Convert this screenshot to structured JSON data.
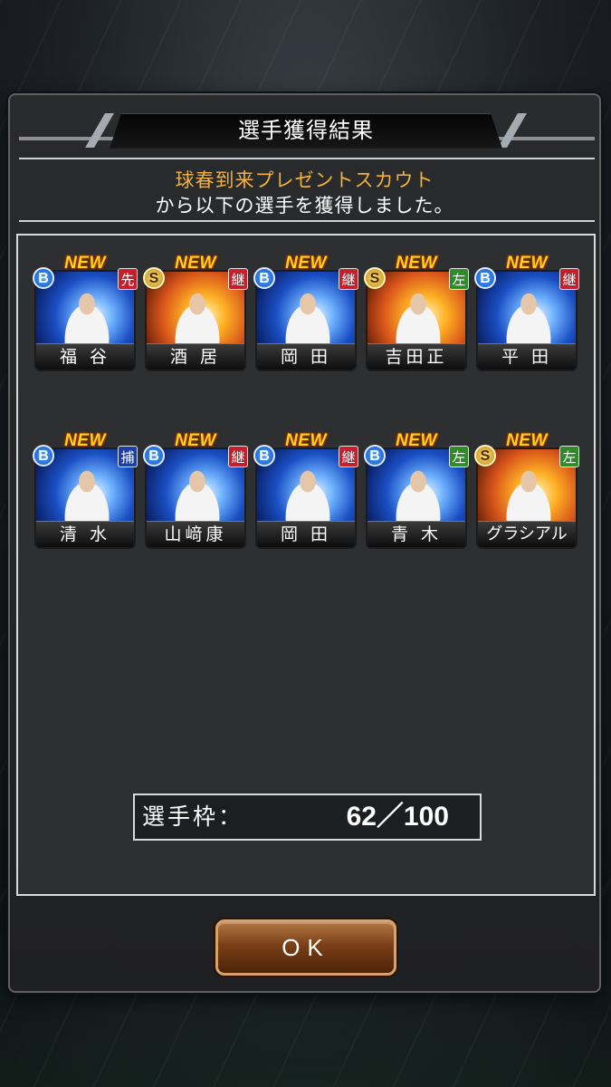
{
  "dialog": {
    "title": "選手獲得結果",
    "subtitle_highlight": "球春到来プレゼントスカウト",
    "subtitle_text": "から以下の選手を獲得しました。"
  },
  "new_label": "NEW",
  "players": [
    {
      "name": "福 谷",
      "rank": "B",
      "position": "先",
      "position_color": "red",
      "card_theme": "blue"
    },
    {
      "name": "酒 居",
      "rank": "S",
      "position": "継",
      "position_color": "red",
      "card_theme": "gold"
    },
    {
      "name": "岡 田",
      "rank": "B",
      "position": "継",
      "position_color": "red",
      "card_theme": "blue"
    },
    {
      "name": "吉田正",
      "rank": "S",
      "position": "左",
      "position_color": "green",
      "card_theme": "gold"
    },
    {
      "name": "平 田",
      "rank": "B",
      "position": "継",
      "position_color": "red",
      "card_theme": "blue"
    },
    {
      "name": "清 水",
      "rank": "B",
      "position": "捕",
      "position_color": "navy",
      "card_theme": "blue"
    },
    {
      "name": "山﨑康",
      "rank": "B",
      "position": "継",
      "position_color": "red",
      "card_theme": "blue"
    },
    {
      "name": "岡 田",
      "rank": "B",
      "position": "継",
      "position_color": "red",
      "card_theme": "blue"
    },
    {
      "name": "青 木",
      "rank": "B",
      "position": "左",
      "position_color": "green",
      "card_theme": "blue"
    },
    {
      "name": "グラシアル",
      "rank": "S",
      "position": "左",
      "position_color": "green",
      "card_theme": "gold"
    }
  ],
  "roster": {
    "label": "選手枠：",
    "count": "62／100"
  },
  "ok_button": {
    "label": "OK"
  }
}
